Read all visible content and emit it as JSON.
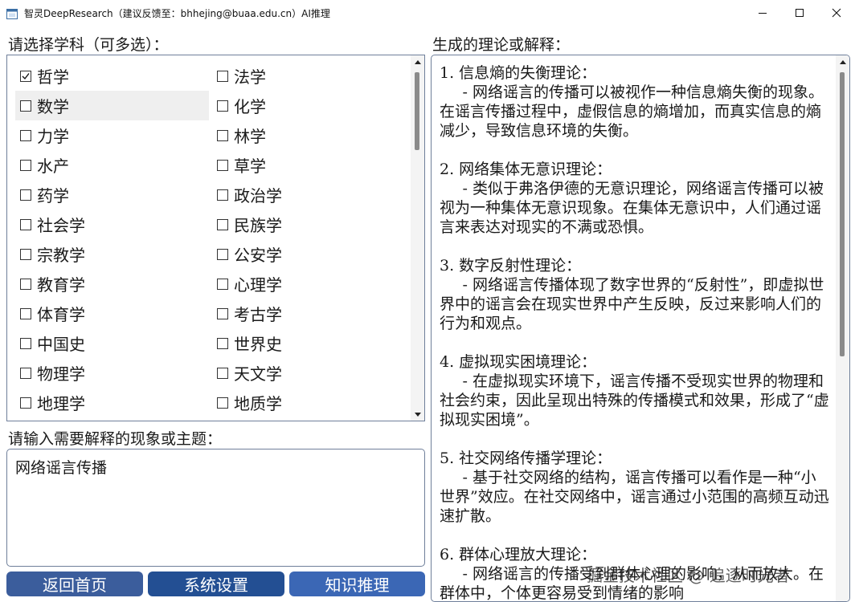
{
  "window": {
    "title": "智灵DeepResearch（建议反馈至：bhhejing@buaa.edu.cn）AI推理",
    "icons": [
      "app-icon",
      "minimize-icon",
      "maximize-icon",
      "close-icon"
    ]
  },
  "subjects": {
    "label": "请选择学科（可多选）：",
    "items": [
      {
        "label": "哲学",
        "checked": true
      },
      {
        "label": "法学",
        "checked": false
      },
      {
        "label": "数学",
        "checked": false
      },
      {
        "label": "化学",
        "checked": false
      },
      {
        "label": "力学",
        "checked": false
      },
      {
        "label": "林学",
        "checked": false
      },
      {
        "label": "水产",
        "checked": false
      },
      {
        "label": "草学",
        "checked": false
      },
      {
        "label": "药学",
        "checked": false
      },
      {
        "label": "政治学",
        "checked": false
      },
      {
        "label": "社会学",
        "checked": false
      },
      {
        "label": "民族学",
        "checked": false
      },
      {
        "label": "宗教学",
        "checked": false
      },
      {
        "label": "公安学",
        "checked": false
      },
      {
        "label": "教育学",
        "checked": false
      },
      {
        "label": "心理学",
        "checked": false
      },
      {
        "label": "体育学",
        "checked": false
      },
      {
        "label": "考古学",
        "checked": false
      },
      {
        "label": "中国史",
        "checked": false
      },
      {
        "label": "世界史",
        "checked": false
      },
      {
        "label": "物理学",
        "checked": false
      },
      {
        "label": "天文学",
        "checked": false
      },
      {
        "label": "地理学",
        "checked": false
      },
      {
        "label": "地质学",
        "checked": false
      }
    ]
  },
  "topic": {
    "label": "请输入需要解释的现象或主题：",
    "value": "网络谣言传播"
  },
  "result": {
    "label": "生成的理论或解释：",
    "paragraphs": [
      {
        "heading": "1.  信息熵的失衡理论：",
        "body": "- 网络谣言的传播可以被视作一种信息熵失衡的现象。在谣言传播过程中，虚假信息的熵增加，而真实信息的熵减少，导致信息环境的失衡。"
      },
      {
        "heading": "2.  网络集体无意识理论：",
        "body": "- 类似于弗洛伊德的无意识理论，网络谣言传播可以被视为一种集体无意识现象。在集体无意识中，人们通过谣言来表达对现实的不满或恐惧。"
      },
      {
        "heading": "3.  数字反射性理论：",
        "body": "- 网络谣言传播体现了数字世界的“反射性”，即虚拟世界中的谣言会在现实世界中产生反映，反过来影响人们的行为和观点。"
      },
      {
        "heading": "4.  虚拟现实困境理论：",
        "body": "- 在虚拟现实环境下，谣言传播不受现实世界的物理和社会约束，因此呈现出特殊的传播模式和效果，形成了“虚拟现实困境”。"
      },
      {
        "heading": "5.  社交网络传播学理论：",
        "body": "- 基于社交网络的结构，谣言传播可以看作是一种“小世界”效应。在社交网络中，谣言通过小范围的高频互动迅速扩散。"
      },
      {
        "heading": "6.  群体心理放大理论：",
        "body": "- 网络谣言的传播受到群体心理的影响，从而放大。在群体中，个体更容易受到情绪的影响"
      }
    ]
  },
  "buttons": {
    "home": "返回首页",
    "settings": "系统设置",
    "infer": "知识推理"
  },
  "watermark": "掘金技术社区 @ 追逐时光者"
}
